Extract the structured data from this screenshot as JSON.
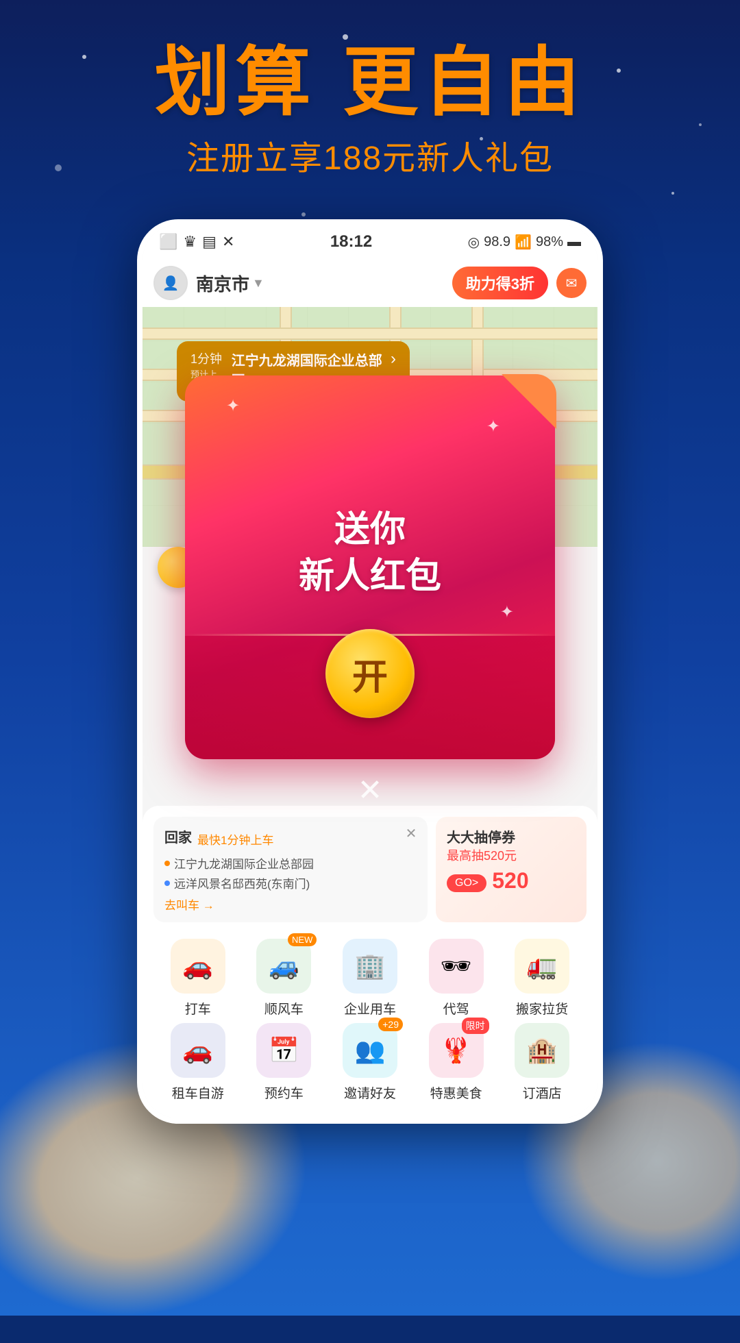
{
  "background": {
    "color_top": "#0d1f5c",
    "color_bottom": "#1e6ad0"
  },
  "hero": {
    "title": "划算 更自由",
    "subtitle": "注册立享188元新人礼包"
  },
  "phone": {
    "status_bar": {
      "time": "18:12",
      "battery": "98%",
      "signal": "98.9"
    },
    "map": {
      "city": "南京市",
      "tooltip_time": "1分钟",
      "tooltip_sublabel": "预计上车",
      "tooltip_address": "江宁九龙湖国际企业总部园",
      "help_badge": "助力得3折"
    },
    "redpacket": {
      "title_line1": "送你",
      "title_line2": "新人红包",
      "open_btn": "开"
    },
    "bottom": {
      "card_home": {
        "title": "回家",
        "time_label": "最快1分钟上车",
        "addr1": "江宁九龙湖国际企业总部园",
        "addr2": "远洋风景名邸西苑(东南门)",
        "more": "去叫车 →"
      },
      "card_lottery": {
        "title": "大大抽停券",
        "amount": "最高抽520元",
        "go_btn": "GO>",
        "amount_display": "520"
      },
      "services_row1": [
        {
          "label": "打车",
          "icon": "🚗",
          "color": "#fff3e0",
          "badge": ""
        },
        {
          "label": "顺风车",
          "icon": "🚙",
          "color": "#e8f5e9",
          "badge": "NEW"
        },
        {
          "label": "企业用车",
          "icon": "🏢",
          "color": "#e3f2fd",
          "badge": ""
        },
        {
          "label": "代驾",
          "icon": "👁",
          "color": "#fce4ec",
          "badge": ""
        },
        {
          "label": "搬家拉货",
          "icon": "🚛",
          "color": "#fff8e1",
          "badge": ""
        }
      ],
      "services_row2": [
        {
          "label": "租车自游",
          "icon": "🚗",
          "color": "#e8eaf6",
          "badge": ""
        },
        {
          "label": "预约车",
          "icon": "📅",
          "color": "#f3e5f5",
          "badge": ""
        },
        {
          "label": "邀请好友",
          "icon": "👥",
          "color": "#e0f7fa",
          "badge": "+29"
        },
        {
          "label": "特惠美食",
          "icon": "🦞",
          "color": "#fce4ec",
          "badge": "限时"
        },
        {
          "label": "订酒店",
          "icon": "🏨",
          "color": "#e8f5e9",
          "badge": ""
        }
      ]
    }
  }
}
